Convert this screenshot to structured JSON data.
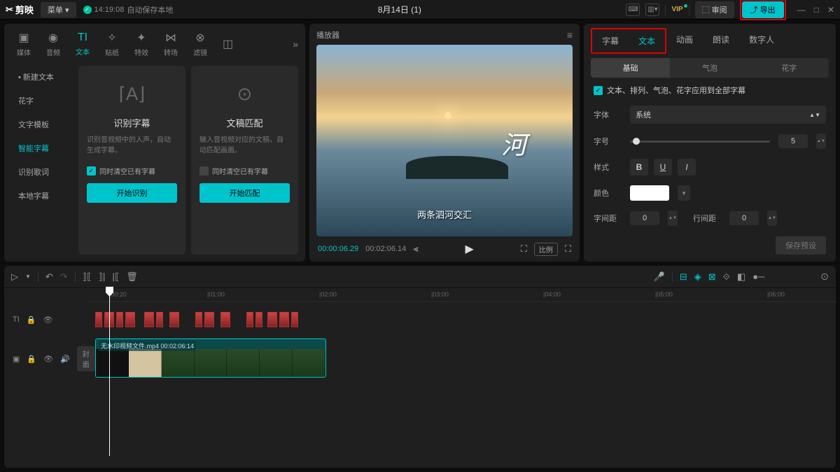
{
  "header": {
    "logo": "剪映",
    "menu": "菜单 ▾",
    "save_time": "14:19:08",
    "save_text": "自动保存本地",
    "title": "8月14日 (1)",
    "vip": "VIP",
    "review": "⬚ 审阅",
    "export": "⤴ 导出"
  },
  "left_panel": {
    "tabs": [
      {
        "icon": "▣",
        "label": "媒体"
      },
      {
        "icon": "◉",
        "label": "音频"
      },
      {
        "icon": "TI",
        "label": "文本"
      },
      {
        "icon": "✧",
        "label": "贴纸"
      },
      {
        "icon": "✦",
        "label": "特效"
      },
      {
        "icon": "⋈",
        "label": "转场"
      },
      {
        "icon": "⊗",
        "label": "滤镜"
      },
      {
        "icon": "◫",
        "label": ""
      }
    ],
    "side": [
      "• 新建文本",
      "花字",
      "文字模板",
      "智能字幕",
      "识别歌词",
      "本地字幕"
    ],
    "card1": {
      "title": "识别字幕",
      "desc": "识别音视频中的人声，自动生成字幕。",
      "chk": "同时清空已有字幕",
      "btn": "开始识别"
    },
    "card2": {
      "title": "文稿匹配",
      "desc": "输入音视频对应的文稿，自动匹配画面。",
      "chk": "同时清空已有字幕",
      "btn": "开始匹配"
    }
  },
  "player": {
    "title": "播放器",
    "overlay_char": "河",
    "subtitle": "两条泗河交汇",
    "tc_cur": "00:00:06.29",
    "tc_tot": "00:02:06.14",
    "ratio": "比例"
  },
  "right_panel": {
    "tabs": [
      "字幕",
      "文本",
      "动画",
      "朗读",
      "数字人"
    ],
    "subtabs": [
      "基础",
      "气泡",
      "花字"
    ],
    "apply_all": "文本、排列、气泡、花字应用到全部字幕",
    "font_lbl": "字体",
    "font_val": "系统",
    "size_lbl": "字号",
    "size_val": "5",
    "style_lbl": "样式",
    "color_lbl": "颜色",
    "ls_lbl": "字间距",
    "ls_val": "0",
    "lh_lbl": "行间距",
    "lh_val": "0",
    "save": "保存预设"
  },
  "timeline": {
    "marks": [
      "|00:20",
      "|01:00",
      "|02:00",
      "|03:00",
      "|04:00",
      "|05:00",
      "|06:00"
    ],
    "text_track": "TI",
    "cover": "封面",
    "clip": "无水印视频文件.mp4  00:02:06:14"
  }
}
